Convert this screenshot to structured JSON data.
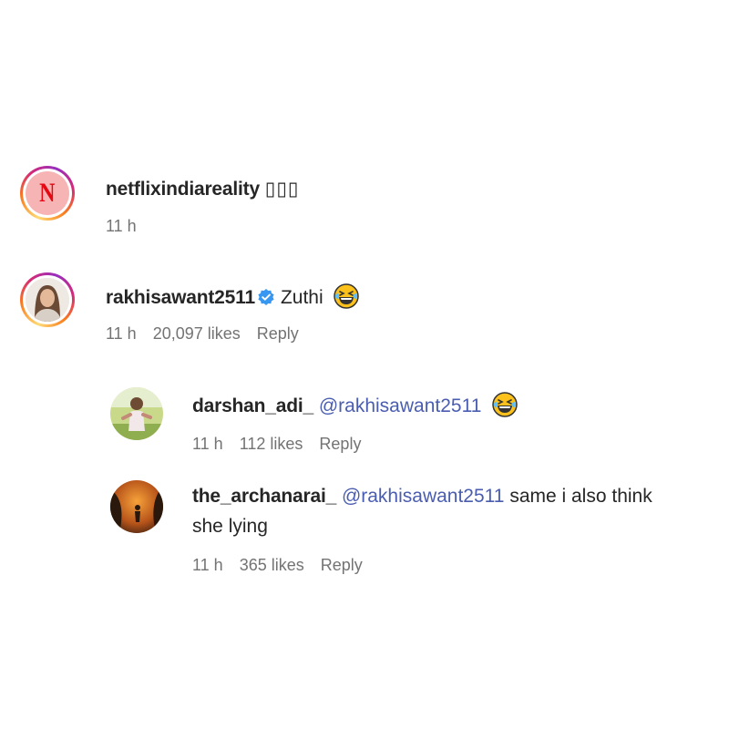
{
  "comments": [
    {
      "username": "netflixindiareality",
      "text": "▯▯▯",
      "time": "11 h",
      "avatar_letter": "N"
    },
    {
      "username": "rakhisawant2511",
      "verified": true,
      "text": "Zuthi",
      "emoji": "laughing-emoji",
      "time": "11 h",
      "likes": "20,097 likes",
      "reply": "Reply"
    }
  ],
  "replies": [
    {
      "username": "darshan_adi_",
      "mention": "@rakhisawant2511",
      "emoji": "laughing-emoji",
      "time": "11 h",
      "likes": "112 likes",
      "reply": "Reply"
    },
    {
      "username": "the_archanarai_",
      "mention": "@rakhisawant2511",
      "text_line1": "same i also think",
      "text_line2": "she lying",
      "time": "11 h",
      "likes": "365 likes",
      "reply": "Reply"
    }
  ],
  "colors": {
    "mention": "#4a5db0",
    "meta": "#737373",
    "netflix_red": "#e50914",
    "verified": "#3897f0"
  }
}
